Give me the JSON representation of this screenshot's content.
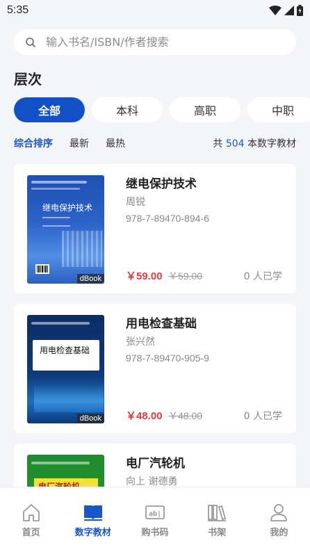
{
  "status_bar": {
    "time": "5:35"
  },
  "search": {
    "placeholder": "输入书名/ISBN/作者搜索"
  },
  "section": {
    "title": "层次"
  },
  "levels": [
    {
      "label": "全部",
      "active": true
    },
    {
      "label": "本科"
    },
    {
      "label": "高职"
    },
    {
      "label": "中职"
    }
  ],
  "sort": {
    "options": [
      "综合排序",
      "最新",
      "最热"
    ],
    "count_prefix": "共",
    "count": "504",
    "count_suffix": "本数字教材"
  },
  "books": [
    {
      "title": "继电保护技术",
      "author": "周锐",
      "isbn": "978-7-89470-894-6",
      "price": "￥59.00",
      "original_price": "￥59.00",
      "learners": "0 人已学",
      "cover_title": "继电保护技术",
      "cover_badge": "dBook",
      "cover_color": "#2d63c9"
    },
    {
      "title": "用电检查基础",
      "author": "张兴然",
      "isbn": "978-7-89470-905-9",
      "price": "￥48.00",
      "original_price": "￥48.00",
      "learners": "0 人已学",
      "cover_title": "用电检查基础",
      "cover_badge": "dBook",
      "cover_color": "#0d3a7d"
    },
    {
      "title": "电厂汽轮机",
      "author": "向上 谢德勇",
      "cover_title": "电厂汽轮机",
      "cover_color": "#1f8a2c"
    }
  ],
  "nav": [
    {
      "label": "首页",
      "icon": "home-icon"
    },
    {
      "label": "数字教材",
      "icon": "open-book-icon",
      "active": true
    },
    {
      "label": "购书码",
      "icon": "code-card-icon"
    },
    {
      "label": "书架",
      "icon": "bookshelf-icon"
    },
    {
      "label": "我的",
      "icon": "user-icon"
    }
  ],
  "colors": {
    "accent": "#1150c7",
    "price": "#e43c3c"
  }
}
